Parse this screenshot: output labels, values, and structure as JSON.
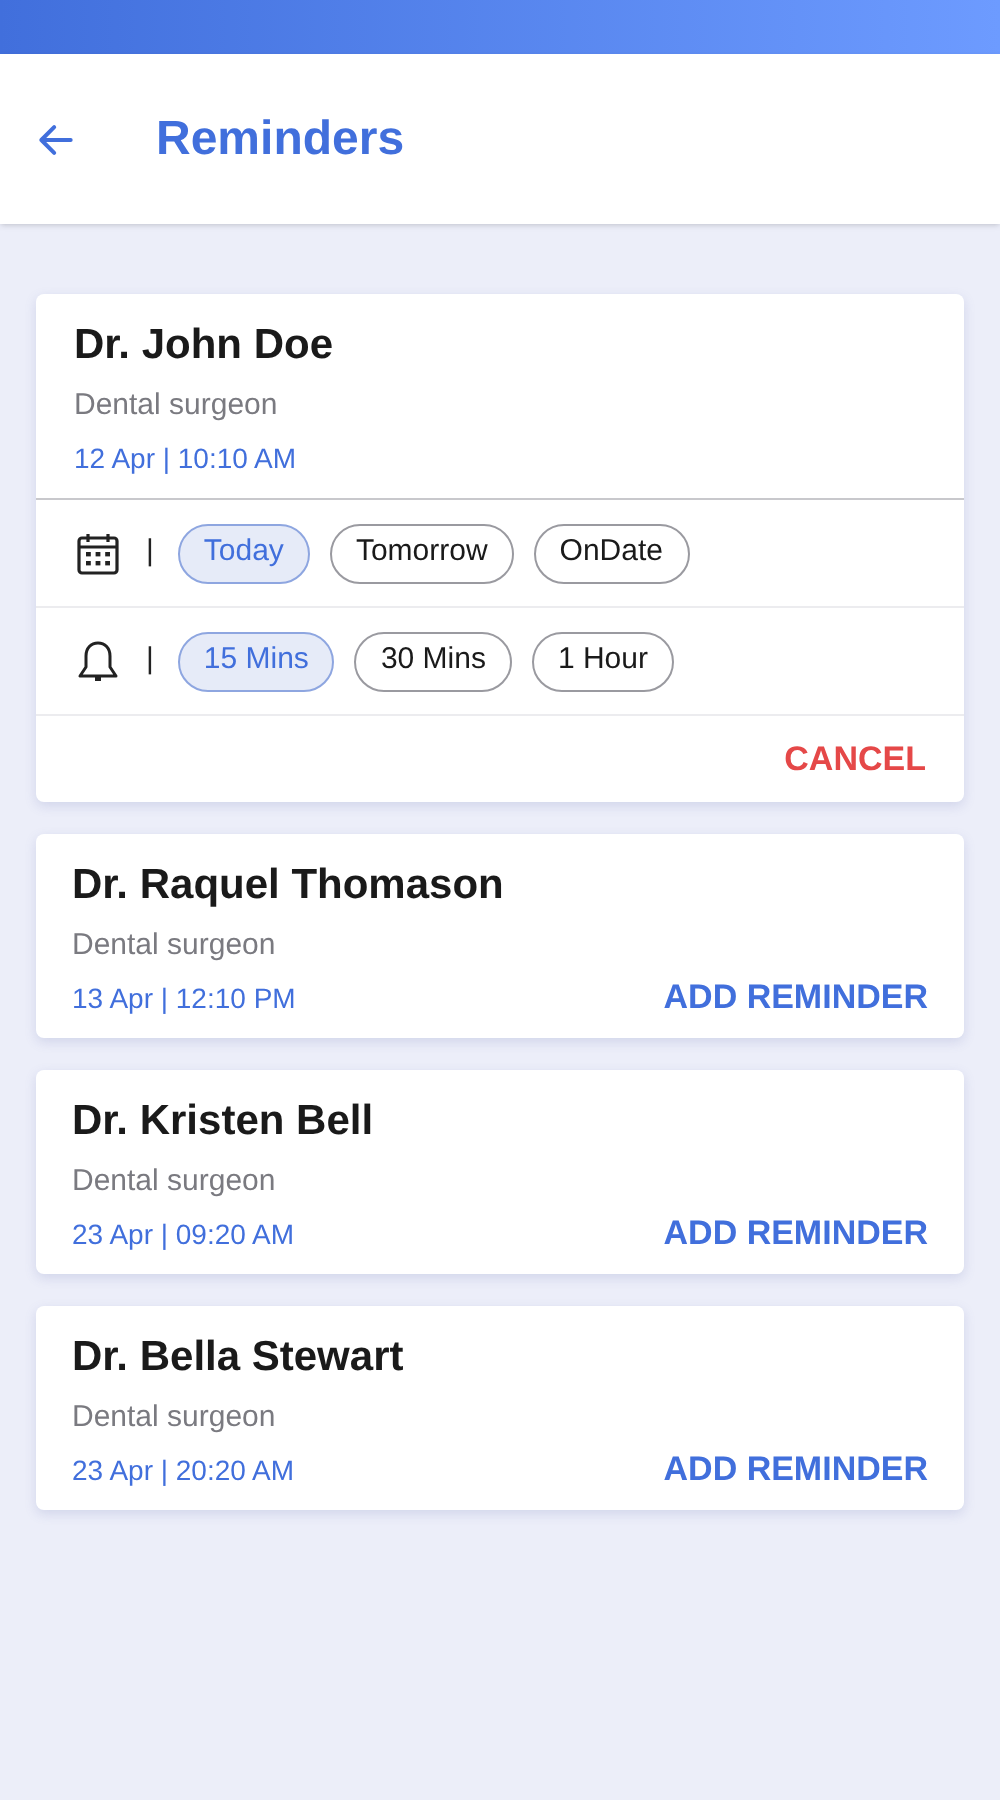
{
  "header": {
    "title": "Reminders"
  },
  "doctors": [
    {
      "name": "Dr. John Doe",
      "specialty": "Dental surgeon",
      "datetime": "12 Apr | 10:10 AM",
      "expanded": true,
      "action": "CANCEL",
      "option_rows": [
        {
          "kind": "date",
          "separator": "|",
          "options": [
            {
              "label": "Today",
              "selected": true
            },
            {
              "label": "Tomorrow",
              "selected": false
            },
            {
              "label": "OnDate",
              "selected": false
            }
          ]
        },
        {
          "kind": "alert",
          "separator": "|",
          "options": [
            {
              "label": "15 Mins",
              "selected": true
            },
            {
              "label": "30 Mins",
              "selected": false
            },
            {
              "label": "1 Hour",
              "selected": false
            }
          ]
        }
      ]
    },
    {
      "name": "Dr. Raquel Thomason",
      "specialty": "Dental surgeon",
      "datetime": "13 Apr | 12:10 PM",
      "expanded": false,
      "action": "ADD REMINDER"
    },
    {
      "name": "Dr. Kristen Bell",
      "specialty": "Dental surgeon",
      "datetime": "23 Apr | 09:20 AM",
      "expanded": false,
      "action": "ADD REMINDER"
    },
    {
      "name": "Dr. Bella Stewart",
      "specialty": "Dental surgeon",
      "datetime": "23 Apr | 20:20 AM",
      "expanded": false,
      "action": "ADD REMINDER"
    }
  ]
}
